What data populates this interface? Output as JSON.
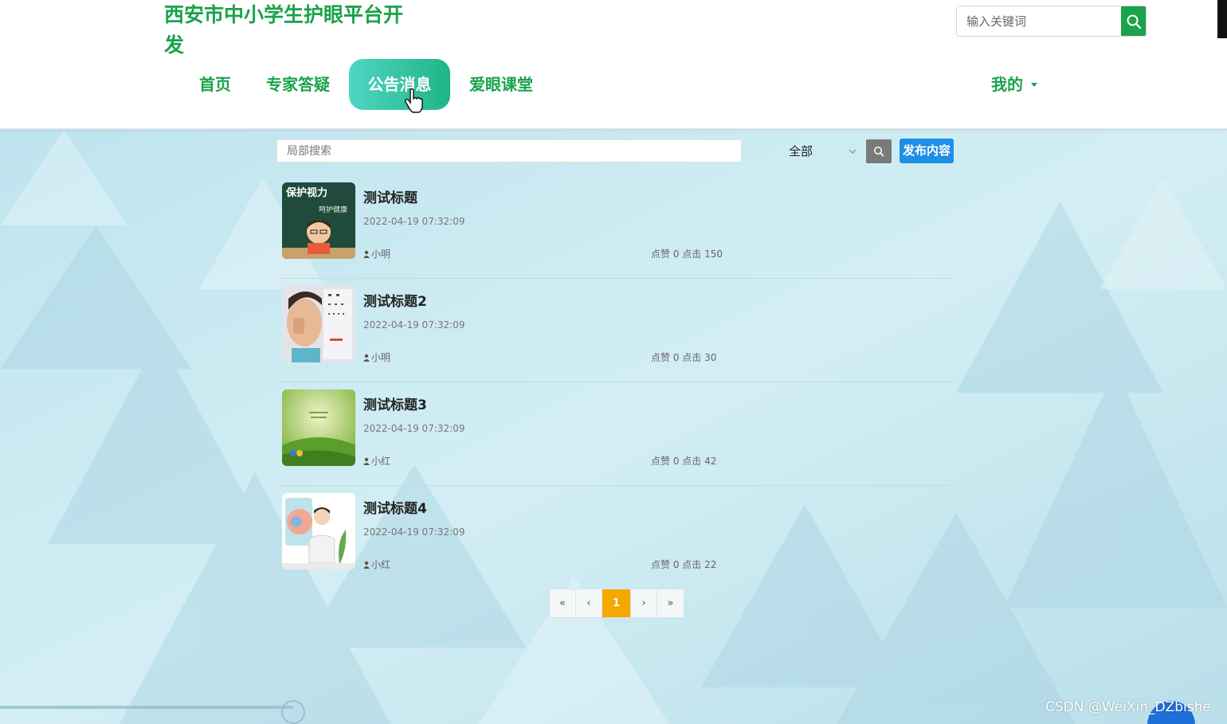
{
  "header": {
    "site_title": "西安市中小学生护眼平台开发",
    "search_placeholder": "输入关键词",
    "nav": [
      {
        "label": "首页"
      },
      {
        "label": "专家答疑"
      },
      {
        "label": "公告消息"
      },
      {
        "label": "爱眼课堂"
      }
    ],
    "mine_label": "我的"
  },
  "filter": {
    "search_placeholder": "局部搜索",
    "category_selected": "全部",
    "publish_label": "发布内容"
  },
  "items": [
    {
      "title": "测试标题",
      "date": "2022-04-19 07:32:09",
      "author": "小明",
      "stats": "点赞 0 点击 150"
    },
    {
      "title": "测试标题2",
      "date": "2022-04-19 07:32:09",
      "author": "小明",
      "stats": "点赞 0 点击 30"
    },
    {
      "title": "测试标题3",
      "date": "2022-04-19 07:32:09",
      "author": "小红",
      "stats": "点赞 0 点击 42"
    },
    {
      "title": "测试标题4",
      "date": "2022-04-19 07:32:09",
      "author": "小红",
      "stats": "点赞 0 点击 22"
    }
  ],
  "thumb_texts": {
    "poster1_line1": "保护视力",
    "poster1_line2": "呵护健康"
  },
  "pagination": {
    "first": "«",
    "prev": "‹",
    "current": "1",
    "next": "›",
    "last": "»"
  },
  "watermark": "CSDN @WeiXin_DZbishe",
  "colors": {
    "brand_green": "#1aa34a",
    "nav_active_start": "#4fd6c4",
    "nav_active_end": "#20b486",
    "publish_blue": "#1e8fe8",
    "page_active": "#f5a800"
  }
}
